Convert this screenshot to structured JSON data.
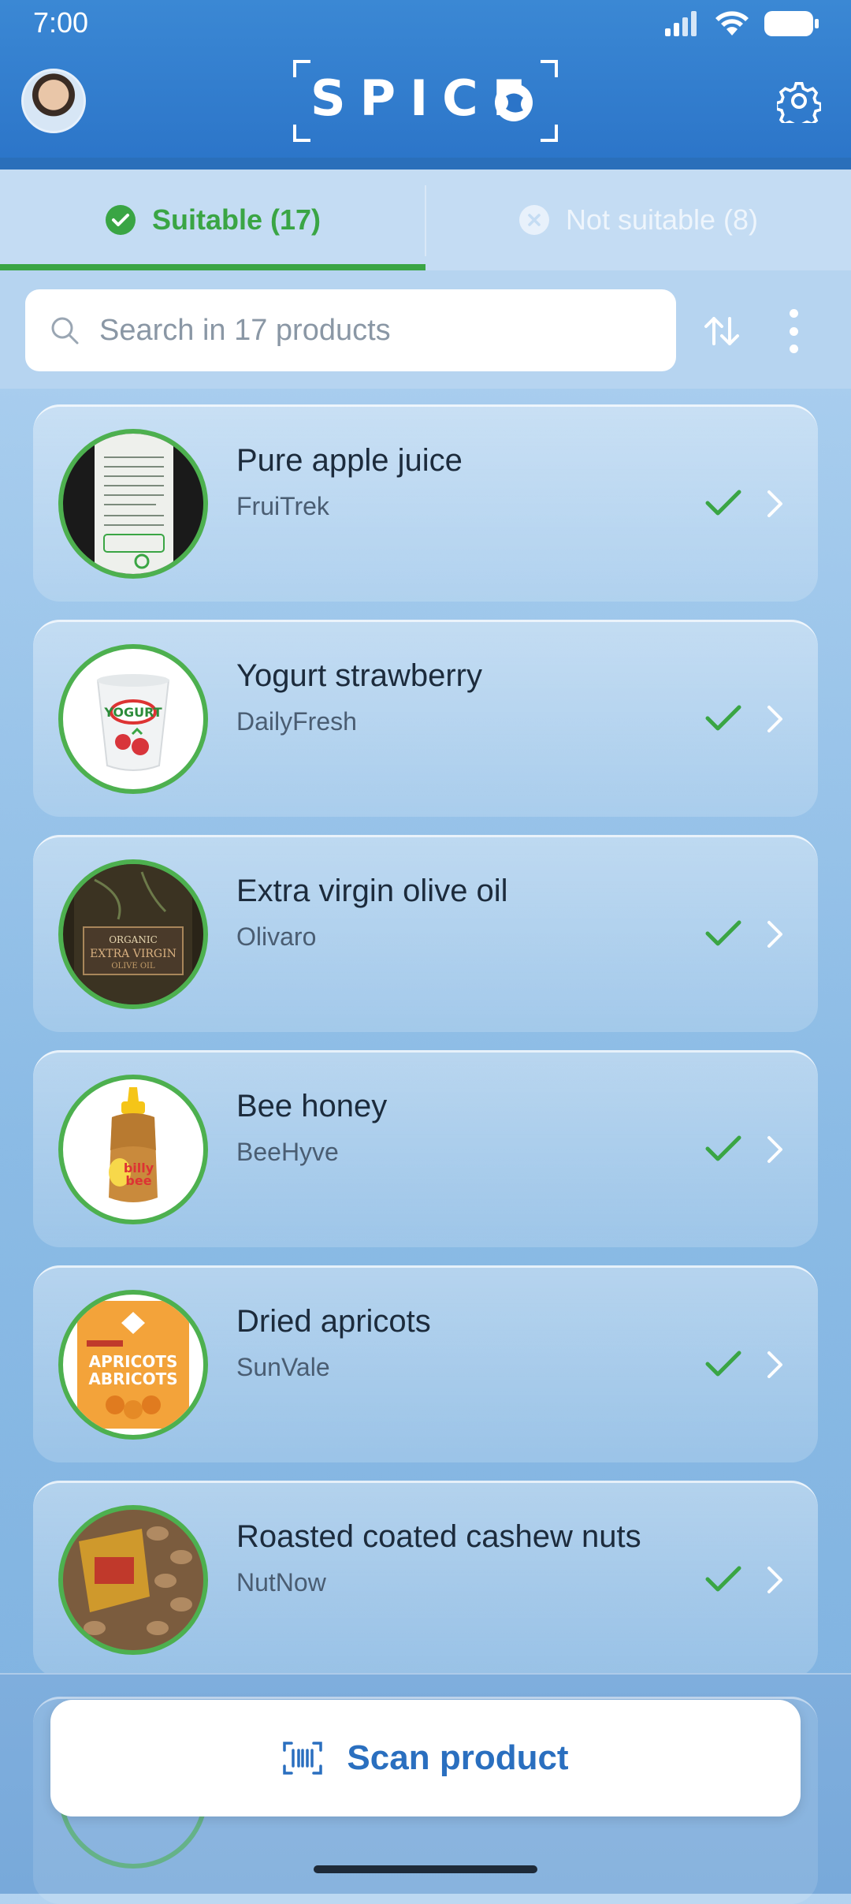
{
  "status": {
    "time": "7:00"
  },
  "header": {
    "logo_text": "SPICE"
  },
  "tabs": [
    {
      "label": "Suitable (17)",
      "active": true
    },
    {
      "label": "Not suitable (8)",
      "active": false
    }
  ],
  "search": {
    "placeholder": "Search in 17 products"
  },
  "products": [
    {
      "name": "Pure apple juice",
      "brand": "FruiTrek"
    },
    {
      "name": "Yogurt strawberry",
      "brand": "DailyFresh"
    },
    {
      "name": "Extra virgin olive oil",
      "brand": "Olivaro"
    },
    {
      "name": "Bee honey",
      "brand": "BeeHyve"
    },
    {
      "name": "Dried apricots",
      "brand": "SunVale"
    },
    {
      "name": "Roasted coated cashew nuts",
      "brand": "NutNow"
    }
  ],
  "scan_button": {
    "label": "Scan product"
  },
  "colors": {
    "accent": "#3aa544",
    "primary": "#2b74c8"
  }
}
